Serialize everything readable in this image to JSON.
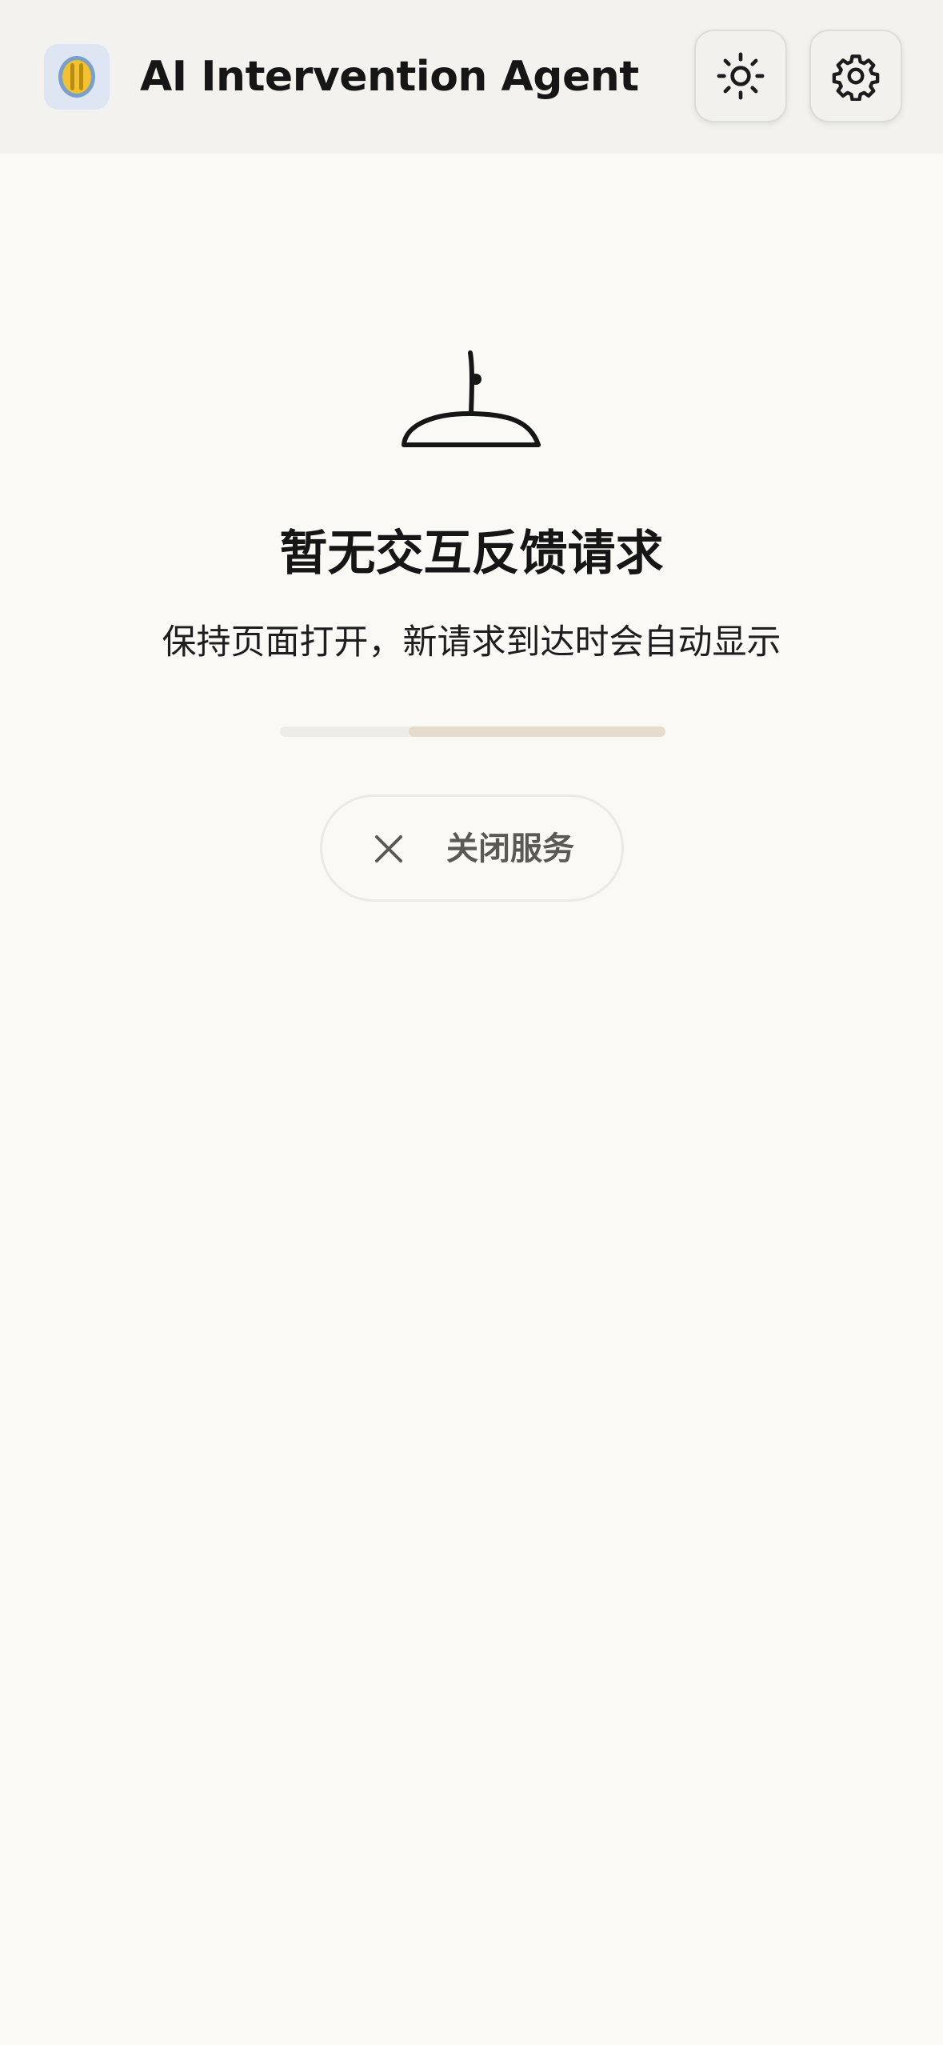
{
  "header": {
    "title": "AI Intervention Agent",
    "logo_icon": "app-logo-icon",
    "theme_toggle_icon": "sun-icon",
    "settings_icon": "gear-icon"
  },
  "empty_state": {
    "illustration_icon": "empty-tray-icon",
    "title": "暂无交互反馈请求",
    "subtitle": "保持页面打开，新请求到达时会自动显示",
    "progress": 0.67
  },
  "close_service": {
    "label": "关闭服务",
    "icon": "close-icon"
  },
  "colors": {
    "background": "#faf9f6",
    "header_background": "#f3f2ee",
    "text_primary": "#161616",
    "button_text": "#5b5955",
    "progress_track": "#eeece8",
    "progress_fill": "#e6dccd",
    "logo_background": "#dfe6f3",
    "logo_accent": "#f2c230"
  }
}
